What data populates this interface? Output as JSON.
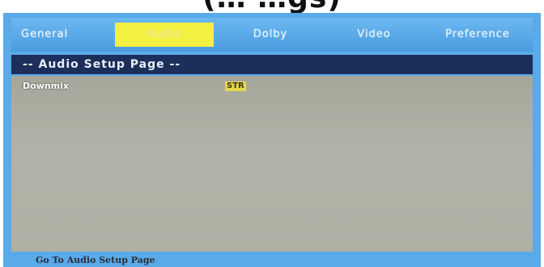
{
  "caption": "(… …gs)",
  "tabs": [
    {
      "label": "General",
      "active": false
    },
    {
      "label": "Audio",
      "active": true
    },
    {
      "label": "Dolby",
      "active": false
    },
    {
      "label": "Video",
      "active": false
    },
    {
      "label": "Preference",
      "active": false
    }
  ],
  "page_header": "-- Audio Setup Page --",
  "settings": [
    {
      "label": "Downmix",
      "value": "STR"
    }
  ],
  "footer": "Go To Audio Setup Page",
  "colors": {
    "frame": "#5aa9e8",
    "header_bar": "#1b2f5a",
    "active_tab": "#f2f040",
    "content_bg": "#aeb0a4",
    "value_highlight": "#e7d64e"
  }
}
